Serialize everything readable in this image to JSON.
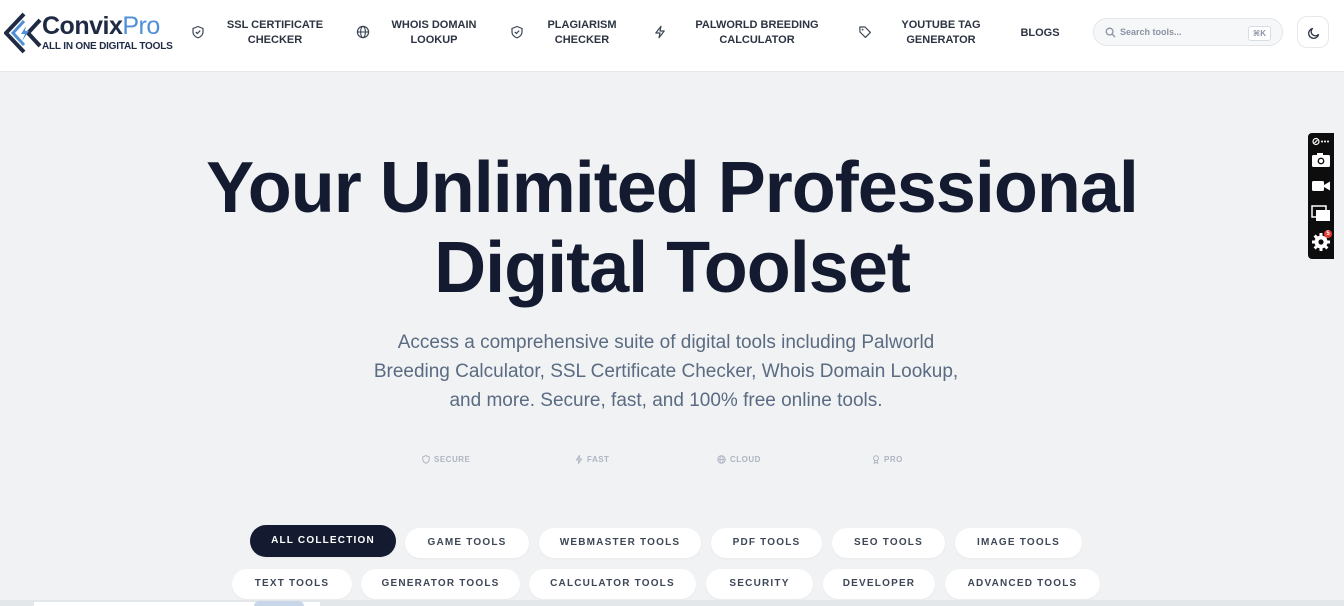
{
  "brand": {
    "name_primary": "Convix",
    "name_secondary": "Pro",
    "tagline": "ALL IN ONE DIGITAL TOOLS",
    "colors": {
      "dark": "#1f2a44",
      "accent": "#4f8fd8"
    }
  },
  "nav": {
    "items": [
      {
        "icon": "shield-check-icon",
        "line1": "SSL CERTIFICATE",
        "line2": "CHECKER"
      },
      {
        "icon": "globe-icon",
        "line1": "WHOIS DOMAIN",
        "line2": "LOOKUP"
      },
      {
        "icon": "shield-check-icon",
        "line1": "PLAGIARISM",
        "line2": "CHECKER"
      },
      {
        "icon": "lightning-icon",
        "line1": "PALWORLD BREEDING",
        "line2": "CALCULATOR"
      },
      {
        "icon": "tag-icon",
        "line1": "YOUTUBE TAG",
        "line2": "GENERATOR"
      }
    ],
    "blogs_label": "BLOGS"
  },
  "search": {
    "placeholder": "Search tools...",
    "shortcut": "⌘K"
  },
  "theme_toggle": {
    "icon": "moon-icon"
  },
  "hero": {
    "title_line1": "Your Unlimited Professional",
    "title_line2": "Digital Toolset",
    "subtitle": "Access a comprehensive suite of digital tools including Palworld Breeding Calculator, SSL Certificate Checker, Whois Domain Lookup, and more. Secure, fast, and 100% free online tools."
  },
  "features": [
    {
      "icon": "shield-icon",
      "label": "SECURE"
    },
    {
      "icon": "lightning-icon",
      "label": "FAST"
    },
    {
      "icon": "globe-icon",
      "label": "CLOUD"
    },
    {
      "icon": "award-icon",
      "label": "PRO"
    }
  ],
  "categories": {
    "row1": [
      "ALL COLLECTION",
      "GAME TOOLS",
      "WEBMASTER TOOLS",
      "PDF TOOLS",
      "SEO TOOLS",
      "IMAGE TOOLS"
    ],
    "row2": [
      "TEXT TOOLS",
      "GENERATOR TOOLS",
      "CALCULATOR TOOLS",
      "SECURITY",
      "DEVELOPER",
      "ADVANCED TOOLS"
    ],
    "active": "ALL COLLECTION"
  },
  "side_toolbar": {
    "items": [
      "link-more-icon",
      "camera-icon",
      "video-icon",
      "windows-icon",
      "settings-icon"
    ],
    "badge": "5"
  },
  "colors": {
    "hero_text": "#141b31",
    "subtitle": "#5a6b82",
    "page_bg": "#f1f2f4"
  }
}
